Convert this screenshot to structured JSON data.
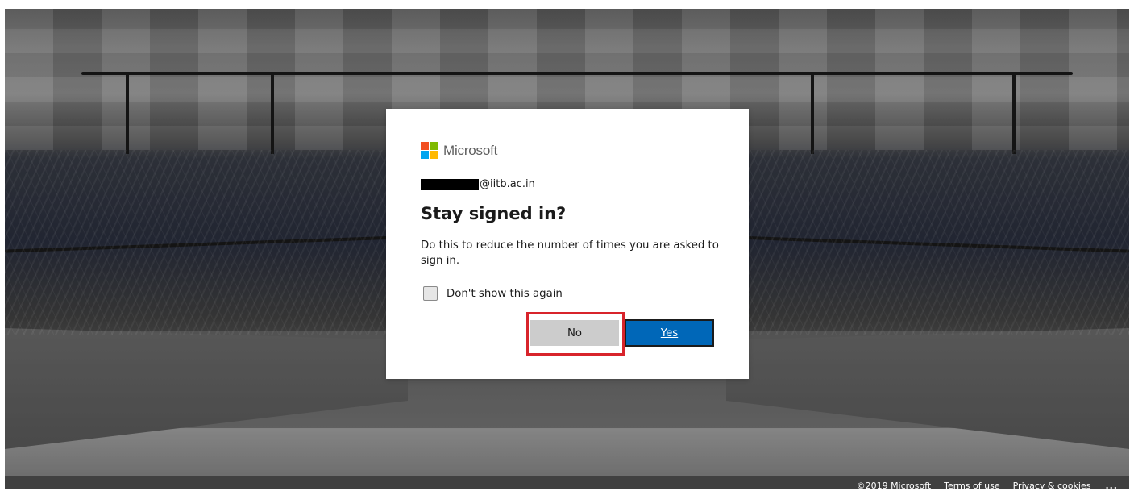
{
  "brand": {
    "name": "Microsoft",
    "logo_colors": [
      "#f25022",
      "#7fba00",
      "#00a4ef",
      "#ffb900"
    ]
  },
  "dialog": {
    "identity_suffix": "@iitb.ac.in",
    "title": "Stay signed in?",
    "description": "Do this to reduce the number of times you are asked to sign in.",
    "checkbox_label": "Don't show this again",
    "checkbox_checked": false,
    "no_label": "No",
    "yes_label": "Yes"
  },
  "colors": {
    "primary": "#0067b8",
    "secondary_button": "#cccccc",
    "highlight": "#d8242b"
  },
  "footer": {
    "copyright": "©2019 Microsoft",
    "terms": "Terms of use",
    "privacy": "Privacy & cookies",
    "more": "..."
  }
}
